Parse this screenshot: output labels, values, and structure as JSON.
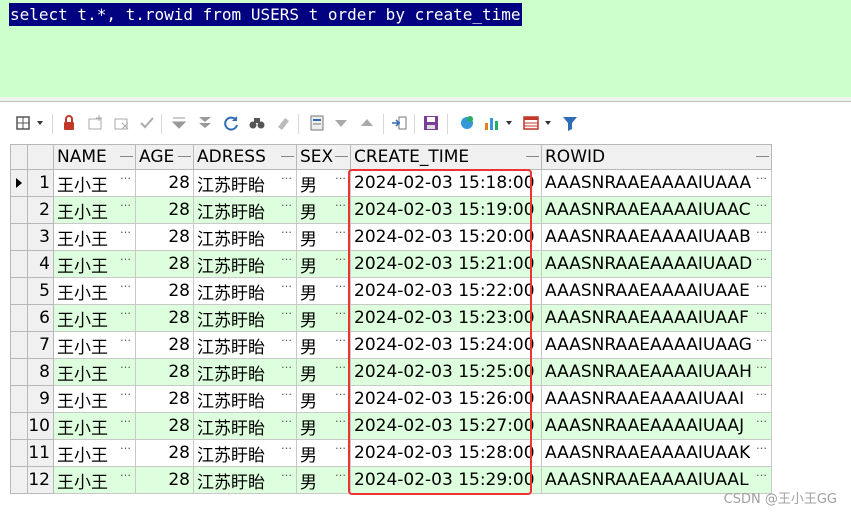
{
  "editor": {
    "sql": "select t.*, t.rowid from USERS t order by create_time"
  },
  "toolbar": {
    "icons": [
      "grid-menu-icon",
      "lock-icon",
      "add-record-icon",
      "delete-record-icon",
      "post-changes-icon",
      "fetch-next-icon",
      "fetch-last-icon",
      "refresh-icon",
      "find-icon",
      "clear-icon",
      "single-record-view-icon",
      "filter-down-icon",
      "filter-up-icon",
      "export-icon",
      "save-icon",
      "query-by-example-icon",
      "chart-icon",
      "grid-table-icon",
      "filter-icon"
    ]
  },
  "grid": {
    "columns": [
      "NAME",
      "AGE",
      "ADRESS",
      "SEX",
      "CREATE_TIME",
      "ROWID"
    ],
    "rows": [
      {
        "n": "1",
        "name": "王小王",
        "age": "28",
        "addr": "江苏盱眙",
        "sex": "男",
        "time": "2024-02-03 15:18:00",
        "rowid": "AAASNRAAEAAAAIUAAA"
      },
      {
        "n": "2",
        "name": "王小王",
        "age": "28",
        "addr": "江苏盱眙",
        "sex": "男",
        "time": "2024-02-03 15:19:00",
        "rowid": "AAASNRAAEAAAAIUAAC"
      },
      {
        "n": "3",
        "name": "王小王",
        "age": "28",
        "addr": "江苏盱眙",
        "sex": "男",
        "time": "2024-02-03 15:20:00",
        "rowid": "AAASNRAAEAAAAIUAAB"
      },
      {
        "n": "4",
        "name": "王小王",
        "age": "28",
        "addr": "江苏盱眙",
        "sex": "男",
        "time": "2024-02-03 15:21:00",
        "rowid": "AAASNRAAEAAAAIUAAD"
      },
      {
        "n": "5",
        "name": "王小王",
        "age": "28",
        "addr": "江苏盱眙",
        "sex": "男",
        "time": "2024-02-03 15:22:00",
        "rowid": "AAASNRAAEAAAAIUAAE"
      },
      {
        "n": "6",
        "name": "王小王",
        "age": "28",
        "addr": "江苏盱眙",
        "sex": "男",
        "time": "2024-02-03 15:23:00",
        "rowid": "AAASNRAAEAAAAIUAAF"
      },
      {
        "n": "7",
        "name": "王小王",
        "age": "28",
        "addr": "江苏盱眙",
        "sex": "男",
        "time": "2024-02-03 15:24:00",
        "rowid": "AAASNRAAEAAAAIUAAG"
      },
      {
        "n": "8",
        "name": "王小王",
        "age": "28",
        "addr": "江苏盱眙",
        "sex": "男",
        "time": "2024-02-03 15:25:00",
        "rowid": "AAASNRAAEAAAAIUAAH"
      },
      {
        "n": "9",
        "name": "王小王",
        "age": "28",
        "addr": "江苏盱眙",
        "sex": "男",
        "time": "2024-02-03 15:26:00",
        "rowid": "AAASNRAAEAAAAIUAAI"
      },
      {
        "n": "10",
        "name": "王小王",
        "age": "28",
        "addr": "江苏盱眙",
        "sex": "男",
        "time": "2024-02-03 15:27:00",
        "rowid": "AAASNRAAEAAAAIUAAJ"
      },
      {
        "n": "11",
        "name": "王小王",
        "age": "28",
        "addr": "江苏盱眙",
        "sex": "男",
        "time": "2024-02-03 15:28:00",
        "rowid": "AAASNRAAEAAAAIUAAK"
      },
      {
        "n": "12",
        "name": "王小王",
        "age": "28",
        "addr": "江苏盱眙",
        "sex": "男",
        "time": "2024-02-03 15:29:00",
        "rowid": "AAASNRAAEAAAAIUAAL"
      }
    ]
  },
  "colors": {
    "selection": "#000080",
    "editor_bg": "#ccffcc",
    "alt_row": "#ddffdd",
    "highlight": "#e33333"
  },
  "watermark": "CSDN @王小王GG"
}
